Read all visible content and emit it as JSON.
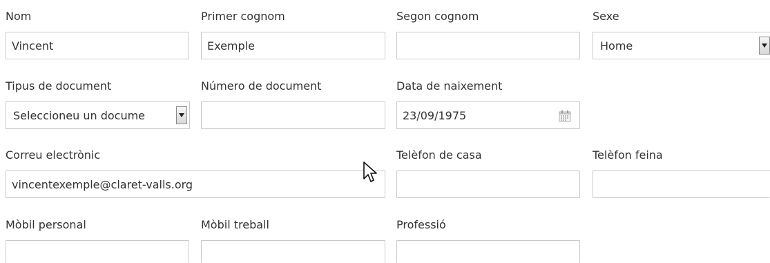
{
  "form": {
    "row1": {
      "nom": {
        "label": "Nom",
        "value": "Vincent"
      },
      "primer_cognom": {
        "label": "Primer cognom",
        "value": "Exemple"
      },
      "segon_cognom": {
        "label": "Segon cognom",
        "value": ""
      },
      "sexe": {
        "label": "Sexe",
        "value": "Home"
      }
    },
    "row2": {
      "tipus_document": {
        "label": "Tipus de document",
        "value": "Seleccioneu un docume"
      },
      "numero_document": {
        "label": "Número de document",
        "value": ""
      },
      "data_naixement": {
        "label": "Data de naixement",
        "value": "23/09/1975"
      }
    },
    "row3": {
      "correu": {
        "label": "Correu electrònic",
        "value": "vincentexemple@claret-valls.org"
      },
      "telefon_casa": {
        "label": "Telèfon de casa",
        "value": ""
      },
      "telefon_feina": {
        "label": "Telèfon feina",
        "value": ""
      }
    },
    "row4": {
      "mobil_personal": {
        "label": "Mòbil personal",
        "value": ""
      },
      "mobil_treball": {
        "label": "Mòbil treball",
        "value": ""
      },
      "professio": {
        "label": "Professió",
        "value": ""
      }
    }
  },
  "icons": {
    "select_arrow": "triangle-down-icon",
    "calendar": "calendar-icon",
    "cursor": "mouse-pointer-icon"
  },
  "colors": {
    "text": "#333333",
    "border": "#c8c8c8",
    "background": "#ffffff"
  }
}
